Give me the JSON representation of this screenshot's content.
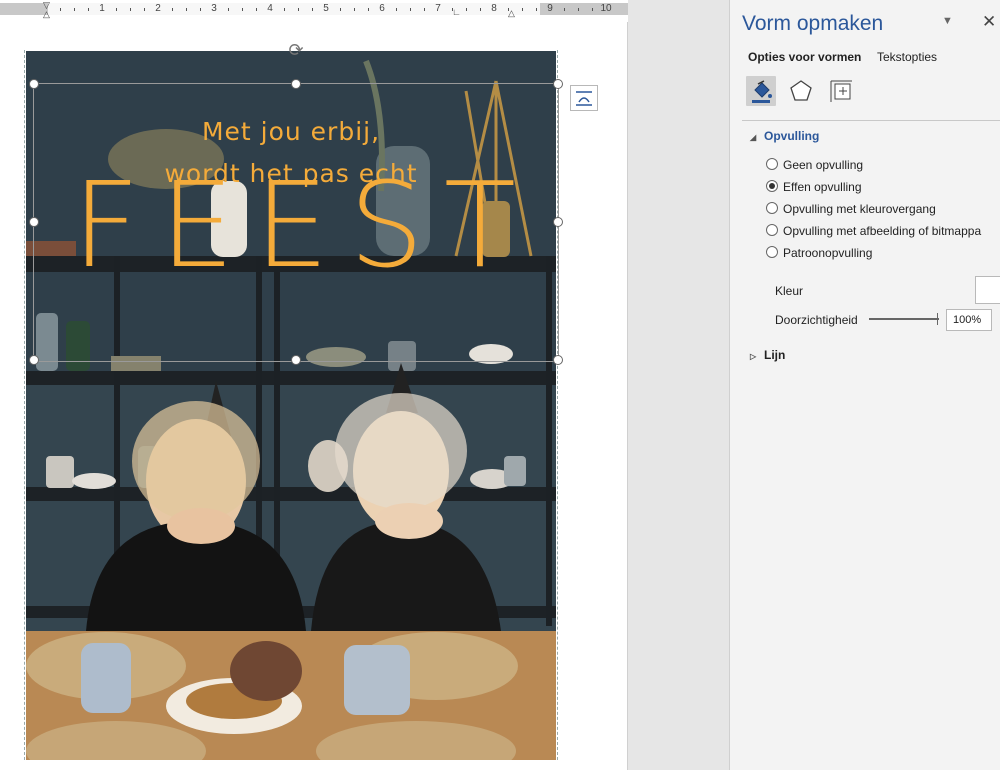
{
  "ruler": {
    "numbers": [
      "1",
      "2",
      "3",
      "4",
      "5",
      "6",
      "7",
      "8",
      "9",
      "10"
    ]
  },
  "poster": {
    "line1": "Met jou erbij,",
    "line2": "wordt het pas echt",
    "big_word": "FEEST"
  },
  "pane": {
    "title": "Vorm opmaken",
    "dropdown_icon": "chevron-down-icon",
    "close_glyph": "✕",
    "tabs": {
      "shape_options": "Opties voor vormen",
      "text_options": "Tekstopties"
    },
    "categories": [
      "fill-line-icon",
      "effects-icon",
      "size-properties-icon"
    ],
    "fill_section": {
      "title": "Opvulling",
      "options": [
        {
          "label": "Geen opvulling",
          "selected": false
        },
        {
          "label": "Effen opvulling",
          "selected": true
        },
        {
          "label": "Opvulling met kleurovergang",
          "selected": false
        },
        {
          "label": "Opvulling met afbeelding of bitmappa",
          "selected": false
        },
        {
          "label": "Patroonopvulling",
          "selected": false
        }
      ],
      "color_label": "Kleur",
      "color_value": "#ffffff",
      "transparency_label": "Doorzichtigheid",
      "transparency_value": "100%"
    },
    "line_section": {
      "title": "Lijn"
    }
  },
  "colors": {
    "accent": "#2b579a",
    "poster_text": "#f4ab3a"
  }
}
